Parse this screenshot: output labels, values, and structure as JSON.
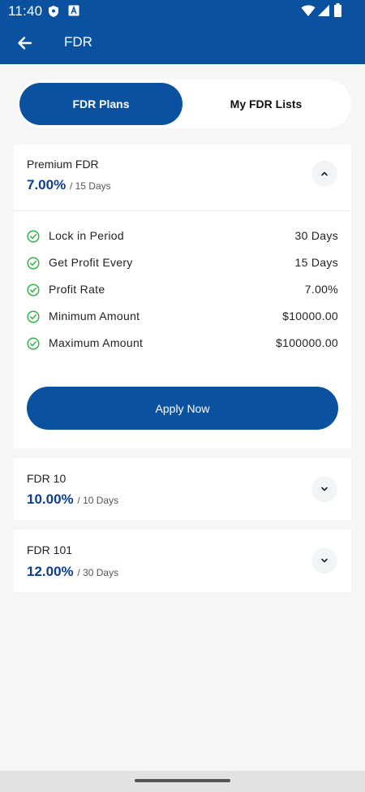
{
  "status_bar": {
    "time": "11:40",
    "icons": [
      "shield-icon",
      "a-badge-icon",
      "wifi-icon",
      "signal-icon",
      "battery-icon"
    ]
  },
  "app_bar": {
    "title": "FDR",
    "back_icon": "arrow-left-icon"
  },
  "tabs": [
    {
      "label": "FDR Plans",
      "active": true
    },
    {
      "label": "My FDR Lists",
      "active": false
    }
  ],
  "plans": [
    {
      "name": "Premium FDR",
      "rate": "7.00%",
      "duration": "/ 15 Days",
      "expanded": true,
      "details": [
        {
          "label": "Lock in Period",
          "value": "30 Days"
        },
        {
          "label": "Get Profit Every",
          "value": "15 Days"
        },
        {
          "label": "Profit Rate",
          "value": "7.00%"
        },
        {
          "label": "Minimum Amount",
          "value": "$10000.00"
        },
        {
          "label": "Maximum Amount",
          "value": "$100000.00"
        }
      ],
      "action_label": "Apply Now"
    },
    {
      "name": "FDR 10",
      "rate": "10.00%",
      "duration": "/ 10 Days",
      "expanded": false
    },
    {
      "name": "FDR 101",
      "rate": "12.00%",
      "duration": "/ 30 Days",
      "expanded": false
    }
  ],
  "colors": {
    "primary": "#0a52a0",
    "rate_text": "#0a3f8f",
    "check": "#35b44a",
    "background": "#f6f6f6"
  }
}
